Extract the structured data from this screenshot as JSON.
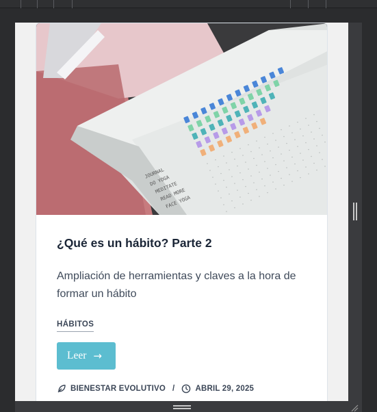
{
  "post": {
    "title": "¿Qué es un hábito? Parte 2",
    "excerpt": "Ampliación de herramientas y claves a la hora de formar un hábito",
    "category": "HÁBITOS",
    "read_label": "Leer",
    "read_arrow": "→",
    "author": "BIENESTAR EVOLUTIVO",
    "separator": "/",
    "date": "ABRIL 29, 2025"
  },
  "image": {
    "tracker_rows": [
      "JOURNAL",
      "DO YOGA",
      "MEDITATE",
      "READ MORE",
      "FACE YOGA"
    ]
  },
  "icons": {
    "author": "feather-pen-icon",
    "date": "clock-icon"
  },
  "colors": {
    "accent": "#5cbdd0",
    "title": "#1a2536",
    "text": "#3f4a5a",
    "background": "#f1f1f1"
  }
}
